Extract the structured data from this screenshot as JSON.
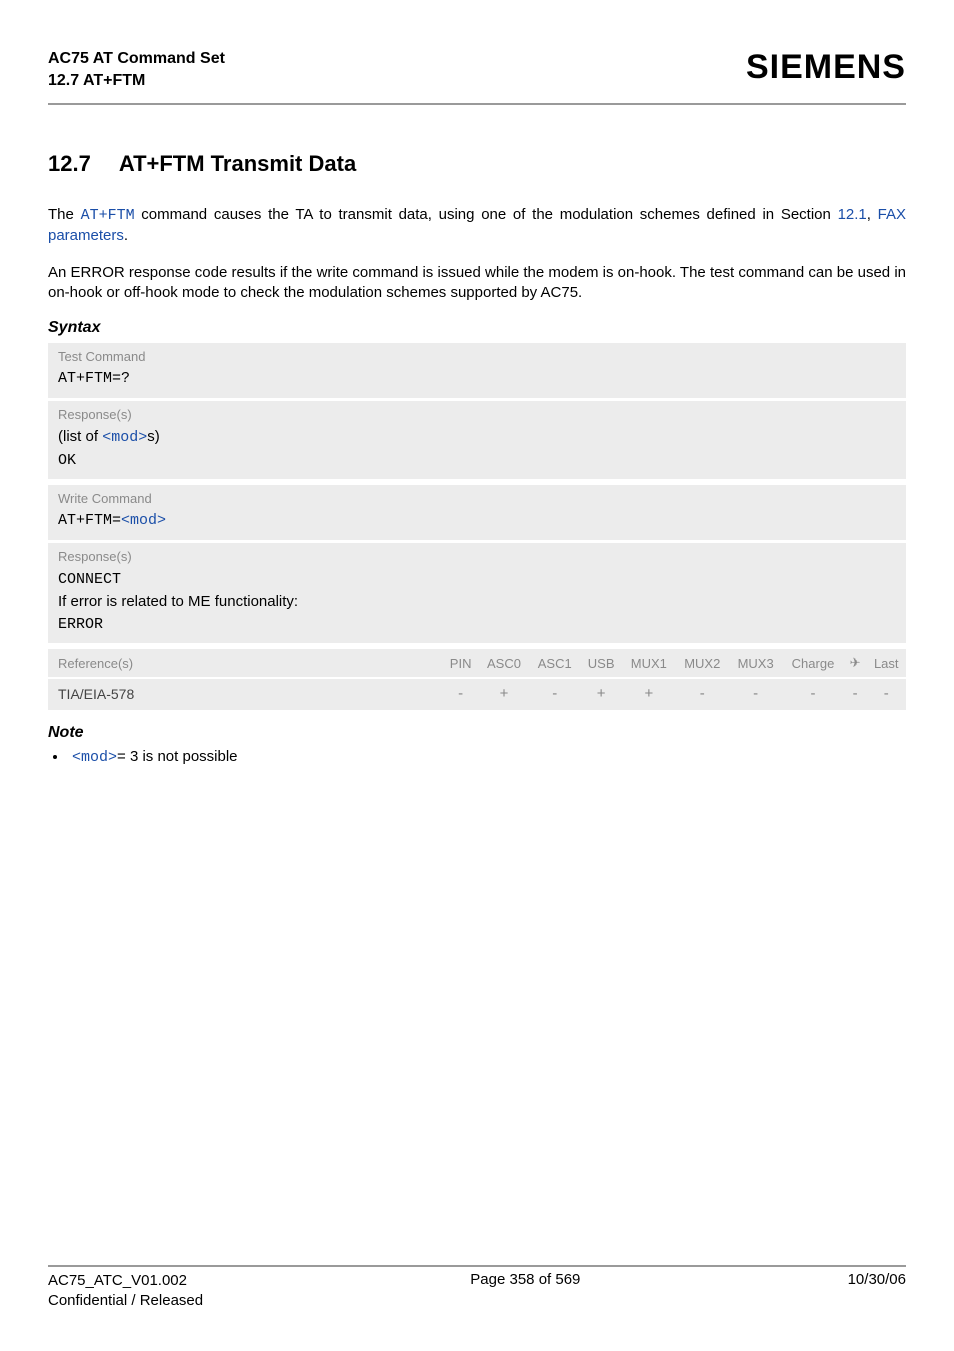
{
  "header": {
    "doc_title": "AC75 AT Command Set",
    "section_ref": "12.7 AT+FTM",
    "brand": "SIEMENS"
  },
  "section": {
    "number": "12.7",
    "title": "AT+FTM   Transmit Data"
  },
  "paragraphs": {
    "p1_pre": "The ",
    "p1_cmd": "AT+FTM",
    "p1_mid": " command causes the TA to transmit data, using one of the modulation schemes defined in Section ",
    "p1_link1": "12.1",
    "p1_comma": ", ",
    "p1_link2": "FAX parameters",
    "p1_end": ".",
    "p2": "An ERROR response code results if the write command is issued while the modem is on-hook. The test command can be used in on-hook or off-hook mode to check the modulation schemes supported by AC75."
  },
  "syntax": {
    "heading": "Syntax",
    "test_label": "Test Command",
    "test_cmd": "AT+FTM=?",
    "response_label": "Response(s)",
    "test_resp_pre": "(list of ",
    "test_resp_mod": "<mod>",
    "test_resp_post": "s)",
    "ok": "OK",
    "write_label": "Write Command",
    "write_cmd_pre": "AT+FTM=",
    "write_cmd_mod": "<mod>",
    "write_resp_connect": "CONNECT",
    "write_resp_err_line": "If error is related to ME functionality:",
    "write_resp_error": "ERROR"
  },
  "reference": {
    "ref_label": "Reference(s)",
    "ref_value": "TIA/EIA-578",
    "cols": [
      "PIN",
      "ASC0",
      "ASC1",
      "USB",
      "MUX1",
      "MUX2",
      "MUX3",
      "Charge",
      "✈",
      "Last"
    ],
    "vals": [
      "-",
      "+",
      "-",
      "+",
      "+",
      "-",
      "-",
      "-",
      "-",
      "-"
    ]
  },
  "note": {
    "heading": "Note",
    "item_mod": "<mod>",
    "item_text": "= 3 is not possible"
  },
  "footer": {
    "left1": "AC75_ATC_V01.002",
    "left2": "Confidential / Released",
    "center": "Page 358 of 569",
    "right": "10/30/06"
  }
}
